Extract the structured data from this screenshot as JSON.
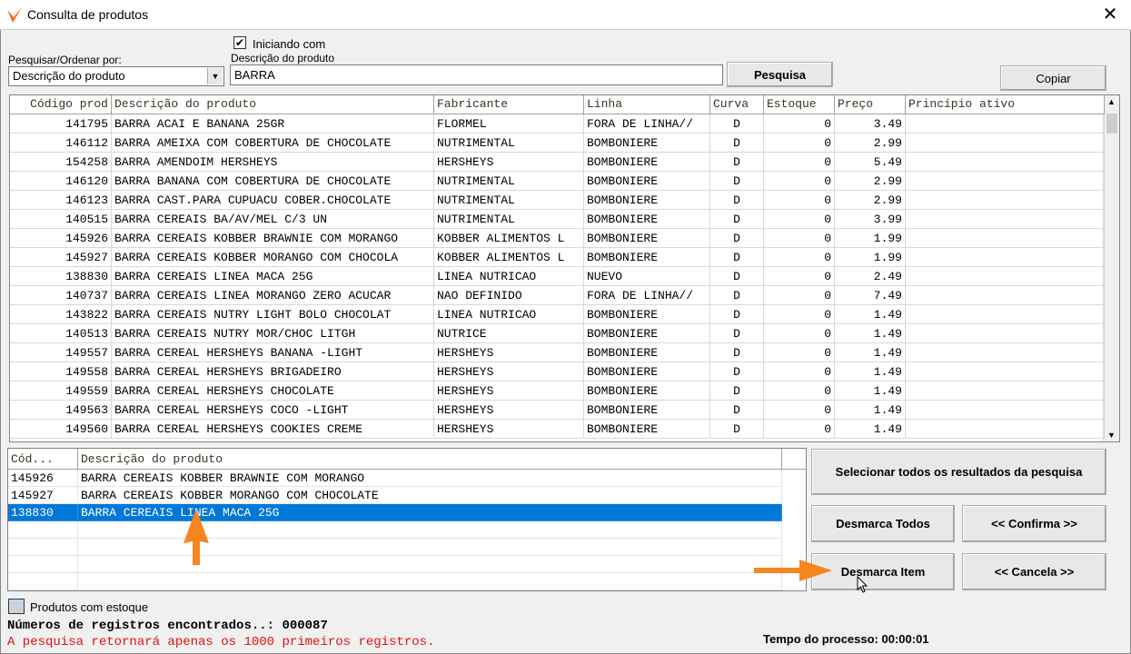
{
  "window": {
    "title": "Consulta de produtos",
    "accent": "#f26b22"
  },
  "search": {
    "starts_with_label": "Iniciando com",
    "starts_with_checked": true,
    "order_label": "Pesquisar/Ordenar por:",
    "order_value": "Descrição do produto",
    "field_label": "Descrição do produto",
    "field_value": "BARRA",
    "search_button": "Pesquisa",
    "copy_button": "Copiar"
  },
  "results": {
    "columns": [
      "Código prod",
      "Descrição do produto",
      "Fabricante",
      "Linha",
      "Curva",
      "Estoque",
      "Preço",
      "Princípio ativo"
    ],
    "rows": [
      [
        "141795",
        "BARRA ACAI E BANANA 25GR",
        "FLORMEL",
        "FORA DE LINHA//",
        "D",
        "0",
        "3.49",
        ""
      ],
      [
        "146112",
        "BARRA AMEIXA COM COBERTURA DE CHOCOLATE",
        "NUTRIMENTAL",
        "BOMBONIERE",
        "D",
        "0",
        "2.99",
        ""
      ],
      [
        "154258",
        "BARRA AMENDOIM HERSHEYS",
        "HERSHEYS",
        "BOMBONIERE",
        "D",
        "0",
        "5.49",
        ""
      ],
      [
        "146120",
        "BARRA BANANA COM COBERTURA DE CHOCOLATE",
        "NUTRIMENTAL",
        "BOMBONIERE",
        "D",
        "0",
        "2.99",
        ""
      ],
      [
        "146123",
        "BARRA CAST.PARA CUPUACU COBER.CHOCOLATE",
        "NUTRIMENTAL",
        "BOMBONIERE",
        "D",
        "0",
        "2.99",
        ""
      ],
      [
        "140515",
        "BARRA CEREAIS BA/AV/MEL C/3 UN",
        "NUTRIMENTAL",
        "BOMBONIERE",
        "D",
        "0",
        "3.99",
        ""
      ],
      [
        "145926",
        "BARRA CEREAIS KOBBER BRAWNIE COM MORANGO",
        "KOBBER ALIMENTOS L",
        "BOMBONIERE",
        "D",
        "0",
        "1.99",
        ""
      ],
      [
        "145927",
        "BARRA CEREAIS KOBBER MORANGO COM CHOCOLA",
        "KOBBER ALIMENTOS L",
        "BOMBONIERE",
        "D",
        "0",
        "1.99",
        ""
      ],
      [
        "138830",
        "BARRA CEREAIS LINEA MACA 25G",
        "LINEA NUTRICAO",
        "NUEVO",
        "D",
        "0",
        "2.49",
        ""
      ],
      [
        "140737",
        "BARRA CEREAIS LINEA MORANGO ZERO ACUCAR",
        "NAO DEFINIDO",
        "FORA DE LINHA//",
        "D",
        "0",
        "7.49",
        ""
      ],
      [
        "143822",
        "BARRA CEREAIS NUTRY LIGHT BOLO CHOCOLAT",
        "LINEA NUTRICAO",
        "BOMBONIERE",
        "D",
        "0",
        "1.49",
        ""
      ],
      [
        "140513",
        "BARRA CEREAIS NUTRY MOR/CHOC LITGH",
        "NUTRICE",
        "BOMBONIERE",
        "D",
        "0",
        "1.49",
        ""
      ],
      [
        "149557",
        "BARRA CEREAL HERSHEYS BANANA -LIGHT",
        "HERSHEYS",
        "BOMBONIERE",
        "D",
        "0",
        "1.49",
        ""
      ],
      [
        "149558",
        "BARRA CEREAL HERSHEYS BRIGADEIRO",
        "HERSHEYS",
        "BOMBONIERE",
        "D",
        "0",
        "1.49",
        ""
      ],
      [
        "149559",
        "BARRA CEREAL HERSHEYS CHOCOLATE",
        "HERSHEYS",
        "BOMBONIERE",
        "D",
        "0",
        "1.49",
        ""
      ],
      [
        "149563",
        "BARRA CEREAL HERSHEYS COCO -LIGHT",
        "HERSHEYS",
        "BOMBONIERE",
        "D",
        "0",
        "1.49",
        ""
      ],
      [
        "149560",
        "BARRA CEREAL HERSHEYS COOKIES CREME",
        "HERSHEYS",
        "BOMBONIERE",
        "D",
        "0",
        "1.49",
        ""
      ]
    ]
  },
  "selected": {
    "columns": [
      "Cód...",
      "Descrição do produto"
    ],
    "rows": [
      [
        "145926",
        "BARRA CEREAIS KOBBER BRAWNIE COM MORANGO"
      ],
      [
        "145927",
        "BARRA CEREAIS KOBBER MORANGO COM CHOCOLATE"
      ],
      [
        "138830",
        "BARRA CEREAIS LINEA MACA 25G"
      ]
    ],
    "highlighted_index": 2,
    "highlight_color": "#0078d7"
  },
  "buttons": {
    "select_all": "Selecionar todos os resultados da pesquisa",
    "unmark_all": "Desmarca Todos",
    "confirm": "<< Confirma >>",
    "unmark_item": "Desmarca Item",
    "cancel": "<< Cancela >>"
  },
  "footer": {
    "stock_label": "Produtos com estoque",
    "stock_checked": false,
    "records": "Números de registros encontrados..: 000087",
    "warning": "A pesquisa retornará apenas os 1000 primeiros registros.",
    "warning_color": "#e01010",
    "process_time": "Tempo do processo: 00:00:01"
  },
  "annotations": {
    "arrow_color": "#f7861e"
  }
}
